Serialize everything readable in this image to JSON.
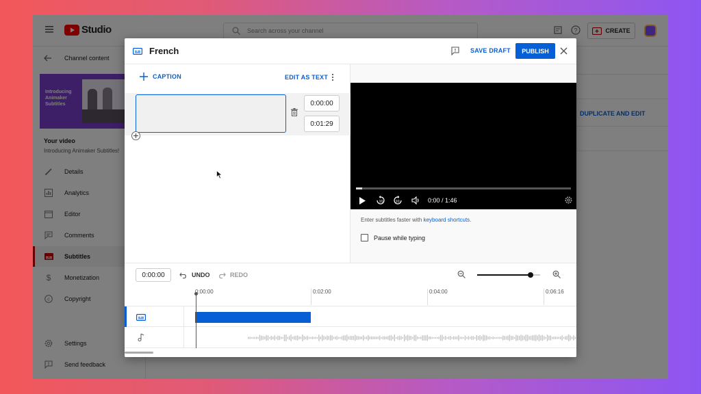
{
  "topbar": {
    "logo_text": "Studio",
    "search_placeholder": "Search across your channel",
    "create_label": "CREATE"
  },
  "sidebar": {
    "back_label": "Channel content",
    "thumbnail_text": "Introducing Animaker Subtitles",
    "your_video_label": "Your video",
    "video_title": "Introducing Animaker Subtitles!",
    "items": [
      {
        "label": "Details",
        "icon": "pencil-icon"
      },
      {
        "label": "Analytics",
        "icon": "analytics-icon"
      },
      {
        "label": "Editor",
        "icon": "editor-icon"
      },
      {
        "label": "Comments",
        "icon": "comments-icon"
      },
      {
        "label": "Subtitles",
        "icon": "subtitles-icon",
        "active": true
      },
      {
        "label": "Monetization",
        "icon": "dollar-icon"
      },
      {
        "label": "Copyright",
        "icon": "copyright-icon"
      }
    ],
    "settings_label": "Settings",
    "feedback_label": "Send feedback"
  },
  "background": {
    "duplicate_label": "DUPLICATE AND EDIT"
  },
  "dialog": {
    "title": "French",
    "save_draft_label": "SAVE DRAFT",
    "publish_label": "PUBLISH",
    "caption_button_label": "CAPTION",
    "edit_as_text_label": "EDIT AS TEXT",
    "caption_text": "",
    "start_time": "0:00:00",
    "end_time": "0:01:29",
    "player": {
      "time_display": "0:00 / 1:46",
      "progress": 0
    },
    "hint_text": "Enter subtitles faster with ",
    "hint_link": "keyboard shortcuts",
    "hint_suffix": ".",
    "pause_label": "Pause while typing",
    "pause_checked": false,
    "timeline": {
      "current_time": "0:00:00",
      "undo_label": "UNDO",
      "redo_label": "REDO",
      "ruler": [
        "0:00:00",
        "0:02:00",
        "0:04:00",
        "0:06:16"
      ],
      "zoom_level": 0.85
    }
  },
  "colors": {
    "accent": "#065fd4",
    "brand_red": "#ff0000",
    "caption_bar": "#065fd4",
    "active_red": "#cc0000"
  }
}
